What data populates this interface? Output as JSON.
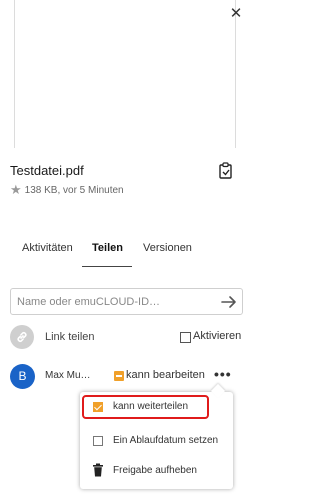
{
  "file": {
    "name": "Testdatei.pdf",
    "meta": "138 KB, vor 5 Minuten"
  },
  "icons": {
    "close": "close-icon",
    "clipboard": "clipboard-icon",
    "star": "star-icon",
    "arrow": "arrow-right-icon",
    "link": "link-icon",
    "more": "more-icon",
    "trash": "trash-icon"
  },
  "tabs": [
    {
      "label": "Aktivitäten",
      "active": false
    },
    {
      "label": "Teilen",
      "active": true
    },
    {
      "label": "Versionen",
      "active": false
    }
  ],
  "share_input": {
    "placeholder": "Name oder emuCLOUD-ID…",
    "value": ""
  },
  "link_share": {
    "label": "Link teilen",
    "activate_label": "Aktivieren",
    "activated": false
  },
  "share_user": {
    "initial": "B",
    "name": "Max Mu…",
    "permission_label": "kann bearbeiten"
  },
  "menu": {
    "items": [
      {
        "label": "kann weiterteilen",
        "checked": true
      },
      {
        "label": "Ein Ablaufdatum setzen",
        "checked": false
      },
      {
        "label": "Freigabe aufheben"
      }
    ]
  },
  "colors": {
    "accent": "#f0a02a",
    "avatar": "#1a63c7",
    "highlight": "#e01b1b"
  }
}
